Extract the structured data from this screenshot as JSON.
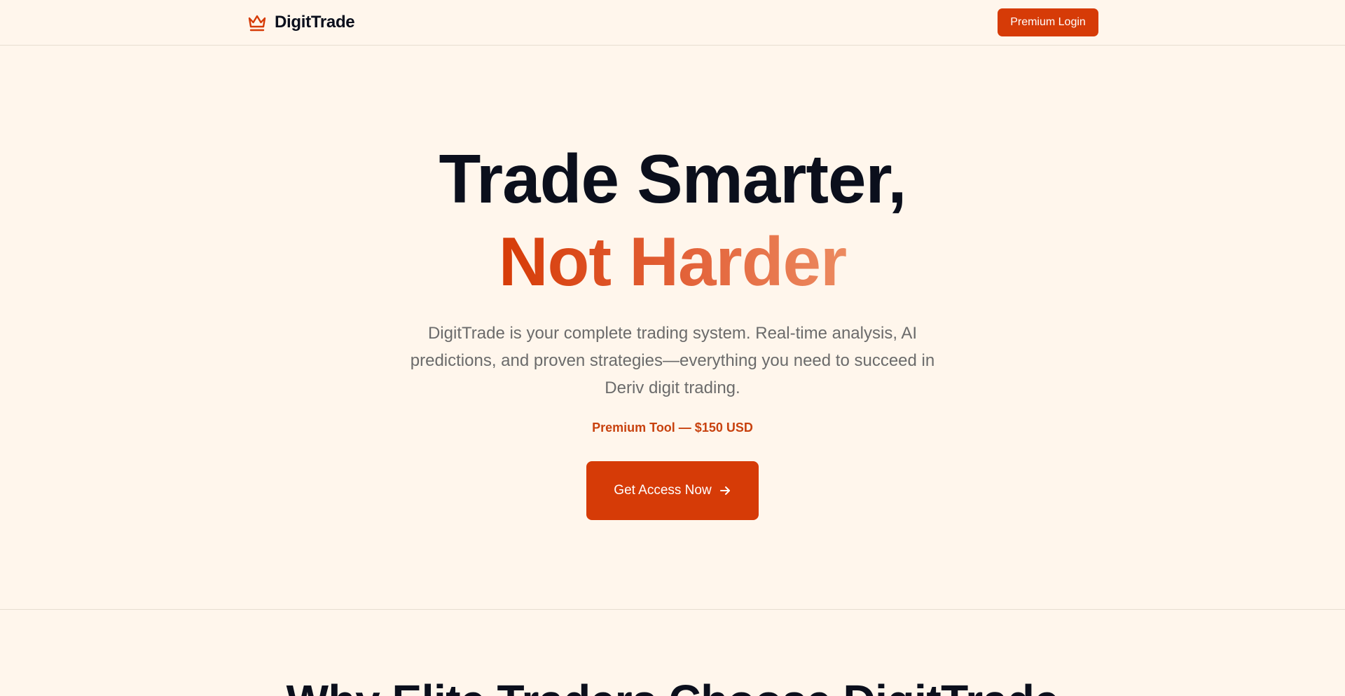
{
  "header": {
    "brand_name": "DigitTrade",
    "brand_icon": "crown-icon",
    "login_label": "Premium Login"
  },
  "hero": {
    "title_line1": "Trade Smarter,",
    "title_line2": "Not Harder",
    "description": "DigitTrade is your complete trading system. Real-time analysis, AI predictions, and proven strategies—everything you need to succeed in Deriv digit trading.",
    "price_note": "Premium Tool — $150 USD",
    "cta_label": "Get Access Now",
    "cta_icon": "arrow-right-icon"
  },
  "features": {
    "title": "Why Elite Traders Choose DigitTrade"
  },
  "colors": {
    "background": "#fff6ec",
    "accent": "#d63b07",
    "heading": "#0b0f1c",
    "muted_text": "#6b6b6b"
  }
}
